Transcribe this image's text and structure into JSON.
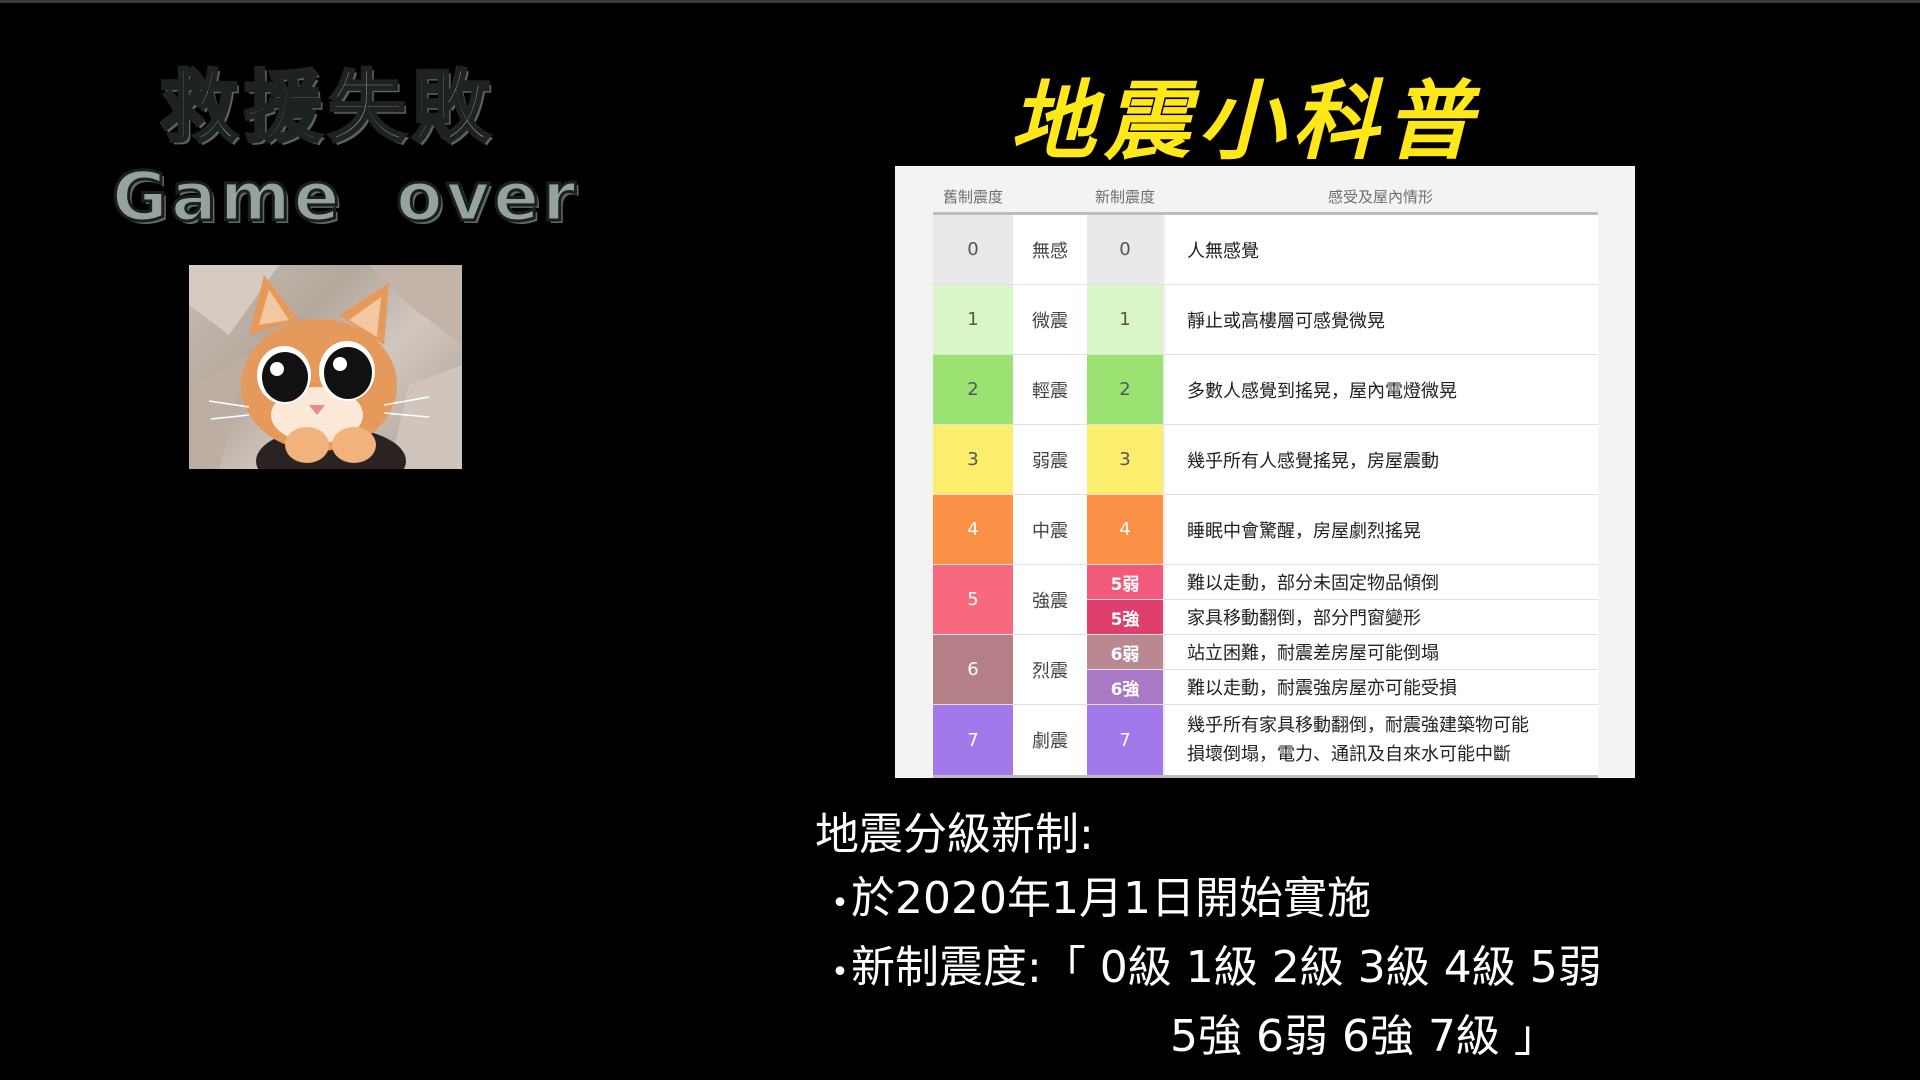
{
  "left": {
    "fail_title": "救援失敗",
    "game_over": "Game  over"
  },
  "right": {
    "title": "地震小科普",
    "table": {
      "headers": {
        "old": "舊制震度",
        "new": "新制震度",
        "desc": "感受及屋內情形"
      },
      "rows": [
        {
          "old": "0",
          "name": "無感",
          "new": "0",
          "desc": "人無感覺",
          "color": "#e9e9e9",
          "text_color": "#555555"
        },
        {
          "old": "1",
          "name": "微震",
          "new": "1",
          "desc": "靜止或高樓層可感覺微晃",
          "color": "#d8f6c8",
          "text_color": "#555555"
        },
        {
          "old": "2",
          "name": "輕震",
          "new": "2",
          "desc": "多數人感覺到搖晃，屋內電燈微晃",
          "color": "#9be272",
          "text_color": "#555555"
        },
        {
          "old": "3",
          "name": "弱震",
          "new": "3",
          "desc": "幾乎所有人感覺搖晃，房屋震動",
          "color": "#fbee6c",
          "text_color": "#555555"
        },
        {
          "old": "4",
          "name": "中震",
          "new": "4",
          "desc": "睡眠中會驚醒，房屋劇烈搖晃",
          "color": "#fb9147",
          "text_color": "#ffffff"
        }
      ],
      "split_rows": [
        {
          "old": "5",
          "name": "強震",
          "color": "#f7697c",
          "subs": [
            {
              "new": "5弱",
              "desc": "難以走動，部分未固定物品傾倒",
              "color": "#f25a7b"
            },
            {
              "new": "5強",
              "desc": "家具移動翻倒，部分門窗變形",
              "color": "#df3f6d"
            }
          ]
        },
        {
          "old": "6",
          "name": "烈震",
          "color": "#b47f86",
          "subs": [
            {
              "new": "6弱",
              "desc": "站立困難，耐震差房屋可能倒塌",
              "color": "#b98890"
            },
            {
              "new": "6強",
              "desc": "難以走動，耐震強房屋亦可能受損",
              "color": "#a979c6"
            }
          ]
        }
      ],
      "last_row": {
        "old": "7",
        "name": "劇震",
        "new": "7",
        "desc_line1": "幾乎所有家具移動翻倒，耐震強建築物可能",
        "desc_line2": "損壞倒塌，電力、通訊及自來水可能中斷",
        "color": "#a378ea"
      }
    },
    "info": {
      "heading": "地震分級新制:",
      "bullet_char": "•",
      "line1": "於2020年1月1日開始實施",
      "line2": "新制震度:「 0級 1級 2級 3級 4級 5弱",
      "line3": "5強 6弱 6強 7級 」"
    }
  }
}
